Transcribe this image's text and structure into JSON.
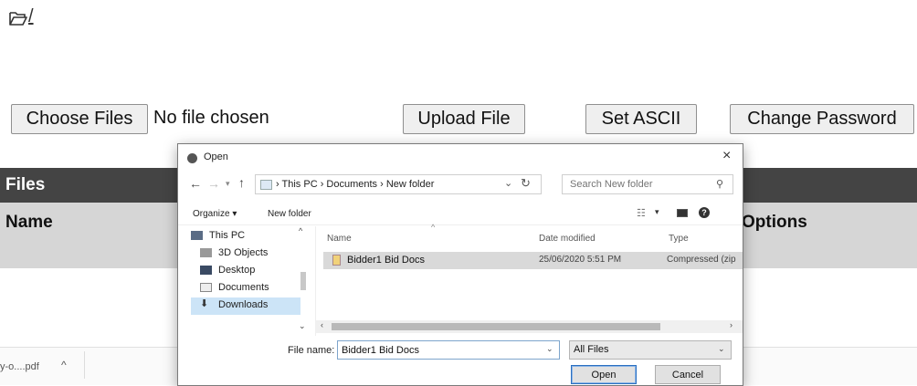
{
  "path": {
    "text": "/"
  },
  "toolbar": {
    "choose_files": "Choose Files",
    "no_file": "No file chosen",
    "upload": "Upload File",
    "ascii": "Set ASCII",
    "change_password": "Change Password"
  },
  "files_table": {
    "title": "Files",
    "col_name": "Name",
    "col_options": "Options"
  },
  "download_bar": {
    "item": "y-o....pdf",
    "caret": "^"
  },
  "dialog": {
    "title": "Open",
    "close": "×",
    "address_crumbs": "› This PC › Documents › New folder",
    "search_placeholder": "Search New folder",
    "organize": "Organize ▾",
    "new_folder": "New folder",
    "nav_items": [
      "This PC",
      "3D Objects",
      "Desktop",
      "Documents",
      "Downloads"
    ],
    "columns": {
      "name": "Name",
      "date": "Date modified",
      "type": "Type"
    },
    "file": {
      "name": "Bidder1 Bid Docs",
      "date": "25/06/2020 5:51 PM",
      "type": "Compressed (zip"
    },
    "file_name_label": "File name:",
    "file_name_value": "Bidder1 Bid Docs",
    "file_type": "All Files",
    "open": "Open",
    "cancel": "Cancel"
  },
  "colors": {
    "table_header": "#444444",
    "columns_row": "#d6d6d6",
    "selection": "#cce4f7"
  },
  "icons": [
    "folder-open-icon",
    "back-arrow-icon",
    "forward-arrow-icon",
    "up-arrow-icon",
    "refresh-icon",
    "search-icon",
    "help-icon",
    "pc-icon",
    "cube-icon",
    "desktop-icon",
    "documents-icon",
    "downloads-icon",
    "zip-file-icon"
  ]
}
